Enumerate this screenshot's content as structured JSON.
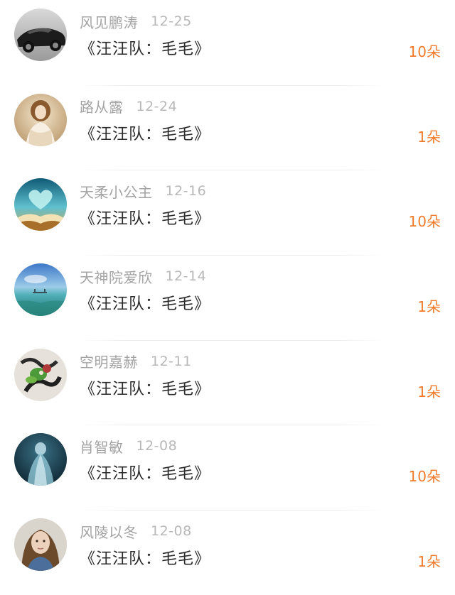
{
  "items": [
    {
      "name": "风见鹏涛",
      "date": "12-25",
      "gift": "《汪汪队：毛毛》",
      "count": "10朵",
      "avatar": "car-avatar"
    },
    {
      "name": "路从露",
      "date": "12-24",
      "gift": "《汪汪队：毛毛》",
      "count": "1朵",
      "avatar": "doll-avatar"
    },
    {
      "name": "天柔小公主",
      "date": "12-16",
      "gift": "《汪汪队：毛毛》",
      "count": "10朵",
      "avatar": "book-heart-avatar"
    },
    {
      "name": "天神院爱欣",
      "date": "12-14",
      "gift": "《汪汪队：毛毛》",
      "count": "1朵",
      "avatar": "sea-avatar"
    },
    {
      "name": "空明嘉赫",
      "date": "12-11",
      "gift": "《汪汪队：毛毛》",
      "count": "1朵",
      "avatar": "art-avatar"
    },
    {
      "name": "肖智敏",
      "date": "12-08",
      "gift": "《汪汪队：毛毛》",
      "count": "10朵",
      "avatar": "veiled-figure-avatar"
    },
    {
      "name": "风陵以冬",
      "date": "12-08",
      "gift": "《汪汪队：毛毛》",
      "count": "1朵",
      "avatar": "portrait-avatar"
    }
  ],
  "colors": {
    "name": "#a3a3a3",
    "date": "#b8b8b8",
    "gift": "#2b2b2b",
    "count": "#f07b2c"
  }
}
